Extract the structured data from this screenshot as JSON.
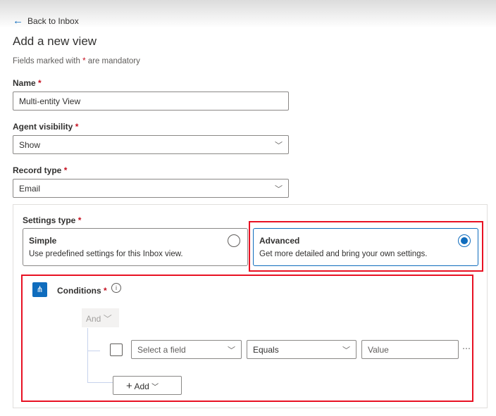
{
  "back": "Back to Inbox",
  "title": "Add a new view",
  "note_pre": "Fields marked with ",
  "note_star": "*",
  "note_post": " are mandatory",
  "name": {
    "label": "Name",
    "value": "Multi-entity View"
  },
  "visibility": {
    "label": "Agent visibility",
    "value": "Show"
  },
  "record": {
    "label": "Record type",
    "value": "Email"
  },
  "settings": {
    "label": "Settings type",
    "simple": {
      "title": "Simple",
      "desc": "Use predefined settings for this Inbox view."
    },
    "advanced": {
      "title": "Advanced",
      "desc": "Get more detailed and bring your own settings."
    }
  },
  "conditions": {
    "label": "Conditions",
    "group": "And",
    "field_placeholder": "Select a field",
    "operator": "Equals",
    "value_placeholder": "Value",
    "add": "Add"
  },
  "star": "*"
}
